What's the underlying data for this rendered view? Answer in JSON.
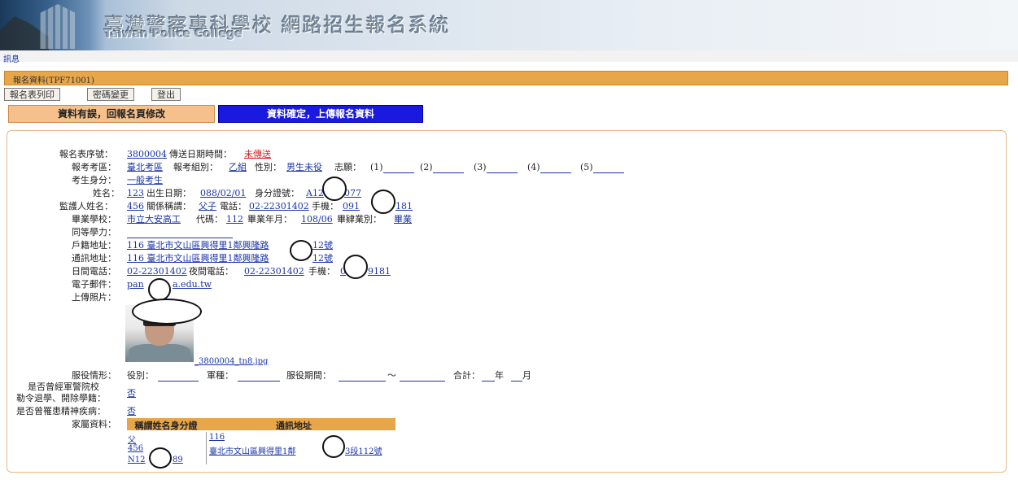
{
  "banner": {
    "title_zh": "臺灣警察專科學校 網路招生報名系統",
    "title_en": "Taiwan Police College",
    "top_link": "訊息"
  },
  "page_bar": {
    "title": "報名資料(TPF71001)"
  },
  "toolbar": {
    "print_label": "報名表列印",
    "password_label": "密碼變更",
    "logout_label": "登出"
  },
  "actions": {
    "back_label": "資料有誤，回報名頁修改",
    "confirm_label": "資料確定，上傳報名資料"
  },
  "form": {
    "reg_no_label": "報名表序號：",
    "reg_no": "3800004",
    "send_time_label": "傳送日期時間：",
    "send_time": "未傳送",
    "exam_area_label": "報考考區：",
    "exam_area": "臺北考區",
    "exam_group_label": "報考組別：",
    "exam_group": "乙組",
    "gender_label": "性別：",
    "gender": "男生未役",
    "wish_label": "志願：",
    "wishes": [
      "(1)",
      "(2)",
      "(3)",
      "(4)",
      "(5)"
    ],
    "status_label": "考生身分：",
    "status": "一般考生",
    "name_label": "姓名：",
    "name": "123",
    "birth_label": "出生日期：",
    "birth": "088/02/01",
    "id_label": "身分證號：",
    "id_left": "A12",
    "id_right": "077",
    "guardian_label": "監護人姓名：",
    "guardian": "456",
    "relation_label": "關係稱謂：",
    "relation": "父子",
    "phone_label": "電話：",
    "phone": "02-22301402",
    "mobile_label": "手機：",
    "mobile_left": "091",
    "mobile_right": "181",
    "school_label": "畢業學校：",
    "school": "市立大安高工",
    "code_label": "代碼：",
    "code": "112",
    "grad_label": "畢業年月：",
    "grad": "108/06",
    "grad_type_label": "畢肄業別：",
    "grad_type": "畢業",
    "equiv_label": "同等學力：",
    "household_label": "戶籍地址：",
    "household_left": "116 臺北市文山區興得里1鄰興隆路",
    "household_right": "12號",
    "mail_label": "通訊地址：",
    "mail_left": "116 臺北市文山區興得里1鄰興隆路",
    "mail_right": "12號",
    "day_phone_label": "日間電話：",
    "day_phone": "02-22301402",
    "night_phone_label": "夜間電話：",
    "night_phone": "02-22301402",
    "mobile2_label": "手機：",
    "mobile2_left": "0",
    "mobile2_right": "9181",
    "email_label": "電子郵件：",
    "email_left": "pan",
    "email_right": "a.edu.tw",
    "photo_label": "上傳照片：",
    "photo_file": "_3800004_tn8.jpg",
    "military_label": "服役情形：",
    "mil_cat_label": "役別：",
    "mil_branch_label": "軍種：",
    "mil_period_label": "服役期間：",
    "mil_period_sep": "～",
    "mil_total_label": "合計：",
    "mil_year": "年",
    "mil_month": "月",
    "expelled_label_1": "是否曾經軍警院校",
    "expelled_label_2": "勒令退學、開除學籍：",
    "expelled": "否",
    "mental_label": "是否曾罹患精神疾病：",
    "mental": "否",
    "family_label": "家屬資料："
  },
  "family_table": {
    "headers": [
      "稱謂姓名身分證",
      "通訊地址"
    ],
    "rows": {
      "relation": "父",
      "name": "456",
      "id_left": "N12",
      "id_right": "89",
      "zip": "116",
      "addr_left": "臺北市文山區興得里1鄰",
      "addr_right": "3段112號"
    }
  }
}
